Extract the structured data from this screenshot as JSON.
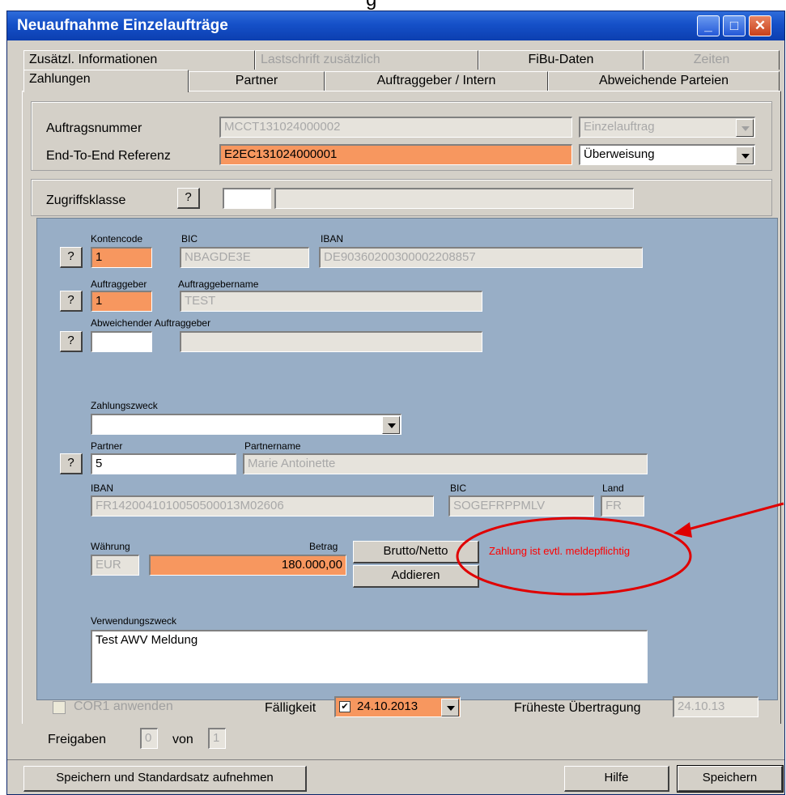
{
  "window": {
    "title": "Neuaufnahme Einzelaufträge"
  },
  "titlebar_buttons": {
    "minimize": "_",
    "maximize": "□",
    "close": "✕"
  },
  "tabs": {
    "row1": [
      {
        "label": "Zusätzl. Informationen",
        "enabled": true
      },
      {
        "label": "Lastschrift zusätzlich",
        "enabled": false
      },
      {
        "label": "FiBu-Daten",
        "enabled": true
      },
      {
        "label": "Zeiten",
        "enabled": false
      }
    ],
    "row2": [
      {
        "label": "Zahlungen",
        "active": true
      },
      {
        "label": "Partner"
      },
      {
        "label": "Auftraggeber / Intern"
      },
      {
        "label": "Abweichende Parteien"
      }
    ]
  },
  "header": {
    "auftragsnummer_label": "Auftragsnummer",
    "auftragsnummer_value": "MCCT131024000002",
    "auftragsart_value": "Einzelauftrag",
    "e2e_label": "End-To-End Referenz",
    "e2e_value": "E2EC131024000001",
    "zahlart_value": "Überweisung"
  },
  "zugriff": {
    "label": "Zugriffsklasse",
    "button": "?",
    "code": "",
    "name": ""
  },
  "orderer": {
    "kontencode_label": "Kontencode",
    "kontencode_value": "1",
    "bic_label": "BIC",
    "bic_value": "NBAGDE3E",
    "iban_label": "IBAN",
    "iban_value": "DE90360200300002208857",
    "auftraggeber_label": "Auftraggeber",
    "auftraggeber_value": "1",
    "auftraggebername_label": "Auftraggebername",
    "auftraggebername_value": "TEST",
    "abweichender_label": "Abweichender Auftraggeber",
    "abweichender_value": "",
    "abweichender_name": "",
    "q_button": "?"
  },
  "payee": {
    "zahlungszweck_label": "Zahlungszweck",
    "zahlungszweck_value": "",
    "partner_label": "Partner",
    "partner_value": "5",
    "partnername_label": "Partnername",
    "partnername_value": "Marie Antoinette",
    "iban_label": "IBAN",
    "iban_value": "FR1420041010050500013M02606",
    "bic_label": "BIC",
    "bic_value": "SOGEFRPPMLV",
    "land_label": "Land",
    "land_value": "FR"
  },
  "amount": {
    "waehrung_label": "Währung",
    "waehrung_value": "EUR",
    "betrag_label": "Betrag",
    "betrag_value": "180.000,00",
    "brutto_netto_button": "Brutto/Netto",
    "addieren_button": "Addieren",
    "warning_text": "Zahlung ist evtl. meldepflichtig",
    "warning_color": "#ff0000"
  },
  "purpose": {
    "verwendungszweck_label": "Verwendungszweck",
    "verwendungszweck_value": "Test AWV Meldung"
  },
  "footer": {
    "cor1_label": "COR1 anwenden",
    "faelligkeit_label": "Fälligkeit",
    "faelligkeit_value": "24.10.2013",
    "frueheste_label": "Früheste Übertragung",
    "frueheste_value": "24.10.13",
    "freigaben_label": "Freigaben",
    "freigaben_value": "0",
    "von_label": "von",
    "von_value": "1"
  },
  "buttons": {
    "save_standard": "Speichern und Standardsatz aufnehmen",
    "help": "Hilfe",
    "save": "Speichern"
  },
  "colors": {
    "highlight_field": "#f7975f",
    "panel_blue": "#98aec6",
    "annotation_red": "#e00000",
    "titlebar": "#1550c8"
  }
}
